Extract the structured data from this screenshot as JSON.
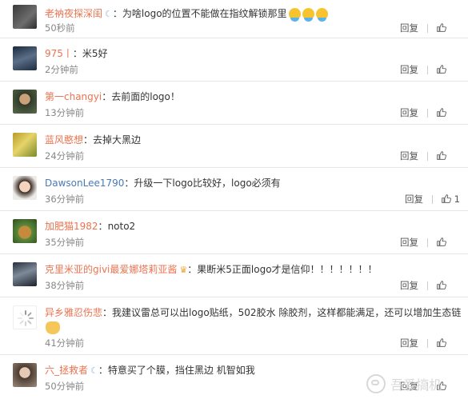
{
  "comments": [
    {
      "name": "老衲夜探深闺",
      "sep": "：",
      "text": "为啥logo的位置不能做在指纹解锁那里",
      "time": "50秒前",
      "reply": "回复",
      "likes": ""
    },
    {
      "name": "975丨",
      "sep": "：",
      "text": "米5好",
      "time": "2分钟前",
      "reply": "回复",
      "likes": ""
    },
    {
      "name": "第一changyi",
      "sep": "：",
      "text": "去前面的logo！",
      "time": "13分钟前",
      "reply": "回复",
      "likes": ""
    },
    {
      "name": "蓝风憨想",
      "sep": "：",
      "text": "去掉大黑边",
      "time": "24分钟前",
      "reply": "回复",
      "likes": ""
    },
    {
      "name": "DawsonLee1790",
      "sep": "：",
      "text": "升级一下logo比较好，logo必须有",
      "time": "36分钟前",
      "reply": "回复",
      "likes": "1"
    },
    {
      "name": "加肥猫1982",
      "sep": "：",
      "text": "noto2",
      "time": "35分钟前",
      "reply": "回复",
      "likes": ""
    },
    {
      "name": "克里米亚的givi最爱娜塔莉亚酱",
      "sep": "：",
      "text": "果断米5正面logo才是信仰！！！！！！！",
      "time": "38分钟前",
      "reply": "回复",
      "likes": ""
    },
    {
      "name": "异乡雅忍伤悲",
      "sep": "：",
      "text": "我建议雷总可以出logo贴纸，502胶水 除胶剂，这样都能满足，还可以增加生态链",
      "time": "41分钟前",
      "reply": "回复",
      "likes": ""
    },
    {
      "name": "六_拯救者",
      "sep": "：",
      "text": "特意买了个膜，挡住黑边 机智如我",
      "time": "50分钟前",
      "reply": "回复",
      "likes": ""
    }
  ],
  "watermark": "吾爱搞机",
  "colors": {
    "name": "#eb7350",
    "time": "#888888",
    "border": "#e6e6e6"
  }
}
